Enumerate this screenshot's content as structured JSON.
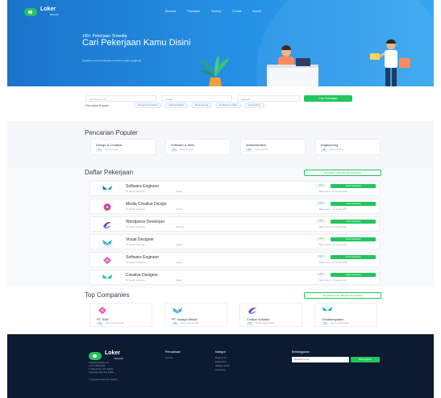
{
  "header": {
    "logo": {
      "name": "Loker",
      "tagline": "Daerah"
    },
    "nav": [
      "Beranda",
      "Pekerjaan",
      "Tentang",
      "Kontak",
      "Masuk"
    ]
  },
  "hero": {
    "eyebrow": "100+ Pekerjaan Tersedia",
    "title": "Cari Pekerjaan Kamu Disini",
    "subtitle": "Dapatkan semua pekerjaan di lembar sudah tergabung"
  },
  "search": {
    "keyword_placeholder": "Cari Kata Kunci",
    "location_placeholder": "Lokasi",
    "category_placeholder": "Kategori",
    "button": "Cari Pekerjaan",
    "popular_label": "Pencarian Populer :",
    "popular_chips": [
      "Design & Creative",
      "Administration",
      "Engineering",
      "Software & Web",
      "Accounting"
    ]
  },
  "popular": {
    "title": "Pencarian Populer",
    "items": [
      {
        "name": "Design & Creative",
        "badge": "24",
        "meta": "Posisi tersedia"
      },
      {
        "name": "Software & Web",
        "badge": "12",
        "meta": "Posisi tersedia"
      },
      {
        "name": "Administration",
        "badge": "08",
        "meta": "Posisi tersedia"
      },
      {
        "name": "Engineering",
        "badge": "15",
        "meta": "Posisi tersedia"
      }
    ]
  },
  "jobs": {
    "title": "Daftar Pekerjaan",
    "view_all": "Tampilkan Lebih Banyak Pekerjaan",
    "items": [
      {
        "title": "Software Engineer",
        "company": "PT Daerah Indonesia",
        "location": "Jakarta",
        "type": "Full",
        "apply": "Lamar Sekarang",
        "meta": "Batas Lamar : 22 Januari 2023",
        "icon": "butterfly-teal"
      },
      {
        "title": "Media Creative Design",
        "company": "PT Daerah Indonesia",
        "location": "Jakarta",
        "type": "Full",
        "apply": "Lamar Sekarang",
        "meta": "Batas Lamar : 22 Januari 2023",
        "icon": "ring-purple"
      },
      {
        "title": "Wordpress Developer",
        "company": "PT Daerah Indonesia",
        "location": "Bandung",
        "type": "Full",
        "apply": "Lamar Sekarang",
        "meta": "Batas Lamar : 22 Januari 2023",
        "icon": "swirl-purple"
      },
      {
        "title": "Visual Designer",
        "company": "PT Daerah Indonesia",
        "location": "Jakarta",
        "type": "Full",
        "apply": "Lamar Sekarang",
        "meta": "Batas Lamar : 22 Januari 2023",
        "icon": "butterfly-blue"
      },
      {
        "title": "Software Engineer",
        "company": "PT Daerah Indonesia",
        "location": "Jakarta",
        "type": "Full",
        "apply": "Lamar Sekarang",
        "meta": "Batas Lamar : 22 Januari 2023",
        "icon": "diamond-pink"
      },
      {
        "title": "Creative Designer",
        "company": "PT Daerah Indonesia",
        "location": "Jakarta",
        "type": "Full",
        "apply": "Lamar Sekarang",
        "meta": "Batas Lamar : 22 Januari 2023",
        "icon": "butterfly-teal"
      }
    ]
  },
  "companies": {
    "title": "Top Companies",
    "view_all": "Tampilkan Lebih Banyak Perusahaan",
    "items": [
      {
        "name": "PT. IDW",
        "badge": "12",
        "meta": "Posisi yang tersedia",
        "icon": "diamond-pink"
      },
      {
        "name": "PT. Saraya Media",
        "badge": "08",
        "meta": "Posisi yang tersedia",
        "icon": "butterfly-blue"
      },
      {
        "name": "Cration Solution",
        "badge": "05",
        "meta": "Posisi yang tersedia",
        "icon": "swirl-purple"
      },
      {
        "name": "Creativesystem",
        "badge": "10",
        "meta": "Posisi yang tersedia",
        "icon": "butterfly-teal"
      }
    ]
  },
  "footer": {
    "logo": {
      "name": "Loker",
      "tagline": "Daerah"
    },
    "contact": [
      "info@lokerdaerah.com",
      "+62 21 0000 0000",
      "Jl. Daerah No. 123, Jakarta",
      "Indonesia, Kode Pos 12345"
    ],
    "copyright": "© Copyright 2023 Loker Daerah",
    "col1": {
      "title": "Perusahaan",
      "links": [
        "Tentang"
      ]
    },
    "col2": {
      "title": "Kategori",
      "links": [
        "Design & Art",
        "Engineering",
        "Software & Web",
        "Accounting"
      ]
    },
    "col3": {
      "title": "Berlangganan",
      "placeholder": "Masukkan email",
      "button": "Berlangganan"
    }
  },
  "colors": {
    "primary": "#1f86dc",
    "accent": "#22c55e",
    "footer": "#0c1b30"
  }
}
